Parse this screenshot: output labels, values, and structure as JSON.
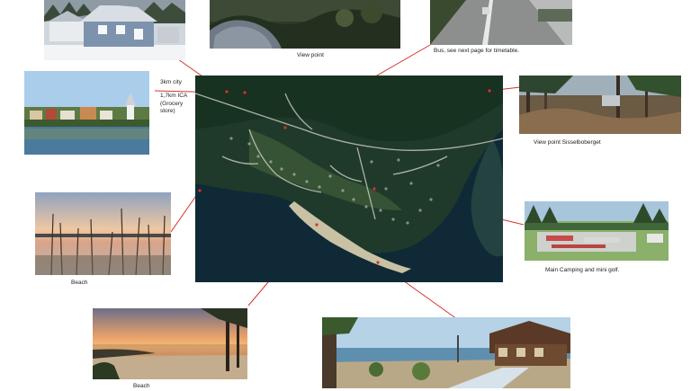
{
  "captions": {
    "view_point": "View point",
    "bus": "Bus, see next page for timetable.",
    "city_line1": "3km city",
    "city_line2": "1,7km ICA",
    "city_line3": "(Grocery",
    "city_line4": "store)",
    "view_point_sisselboberget": "View point Sisselboberget",
    "beach_left": "Beach",
    "main_camping": "Main Camping and mini golf.",
    "beach_bottom": "Beach"
  },
  "colors": {
    "connector": "#d9302b",
    "water": "#0f2a36",
    "forest": "#1f3a2a",
    "road": "#c9c7bd"
  }
}
